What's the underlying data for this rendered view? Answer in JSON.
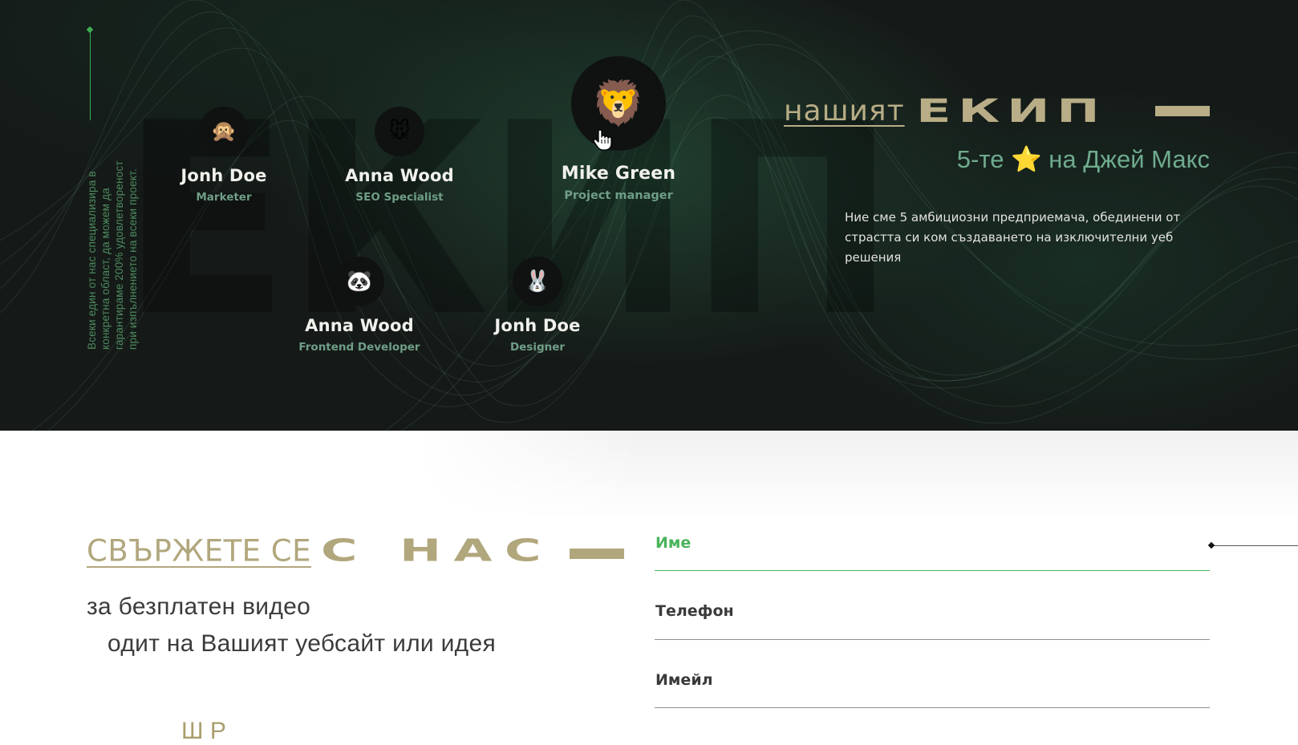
{
  "team": {
    "side_text": "Всеки един от нас специализира в конкретна област, да можем да гарантираме 200% удовлетвореност при изпълнението на всеки проект.",
    "background_word": "ЕКИП",
    "title_light": "нашият",
    "title_bold": "ЕКИП",
    "subtitle_before": "5-те",
    "subtitle_star": "⭐",
    "subtitle_after": "на Джей Макс",
    "description": "Ние сме 5 амбициозни предприемача, обединени от страстта си ком създаването на изключителни уеб решения",
    "members": [
      {
        "name": "Jonh Doe",
        "role": "Marketer",
        "icon": "🙊",
        "icon_name": "monkey-avatar-icon"
      },
      {
        "name": "Anna Wood",
        "role": "SEO Specialist",
        "icon": "🐭",
        "icon_name": "mouse-avatar-icon"
      },
      {
        "name": "Mike Green",
        "role": "Project manager",
        "icon": "🦁",
        "icon_name": "lion-avatar-icon"
      },
      {
        "name": "Anna Wood",
        "role": "Frontend Developer",
        "icon": "🐼",
        "icon_name": "panda-avatar-icon"
      },
      {
        "name": "Jonh Doe",
        "role": "Designer",
        "icon": "🐰",
        "icon_name": "rabbit-avatar-icon"
      }
    ]
  },
  "contact": {
    "title_light": "СВЪРЖЕТЕ СЕ",
    "title_bold": "С НАС",
    "subtitle_line1": "за безплатен видео",
    "subtitle_line2": "одит на Вашият уебсайт или идея",
    "partial_text": "Ш   Р",
    "fields": {
      "name_label": "Име",
      "phone_label": "Телефон",
      "email_label": "Имейл"
    }
  },
  "colors": {
    "dark_bg": "#151a18",
    "gold": "#b8ad86",
    "green_accent": "#49b45a",
    "teal_text": "#6fab8e"
  }
}
